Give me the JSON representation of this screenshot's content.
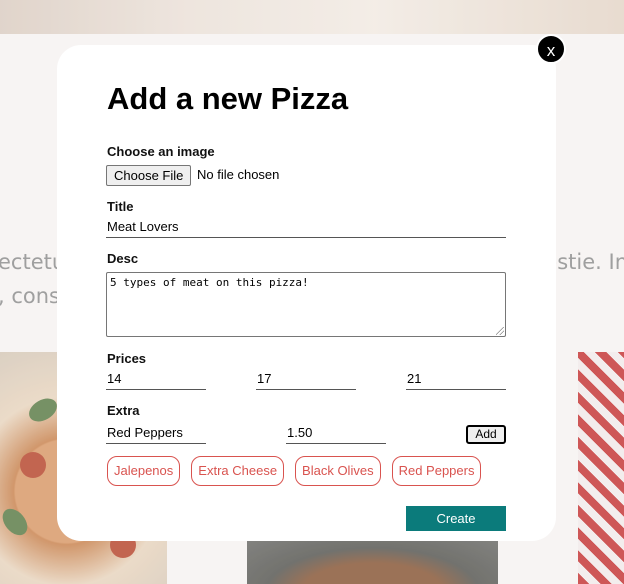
{
  "background": {
    "text_line1_left": "ectetu",
    "text_line2_left": ", cons",
    "text_line1_right": "estie. In"
  },
  "modal": {
    "close_label": "x",
    "title": "Add a new Pizza",
    "image": {
      "label": "Choose an image",
      "button_label": "Choose File",
      "status": "No file chosen"
    },
    "title_field": {
      "label": "Title",
      "value": "Meat Lovers"
    },
    "desc_field": {
      "label": "Desc",
      "value": "5 types of meat on this pizza!"
    },
    "prices": {
      "label": "Prices",
      "values": [
        "14",
        "17",
        "21"
      ]
    },
    "extra": {
      "label": "Extra",
      "name_value": "Red Peppers",
      "price_value": "1.50",
      "add_label": "Add",
      "chips": [
        "Jalepenos",
        "Extra Cheese",
        "Black Olives",
        "Red Peppers"
      ]
    },
    "create_label": "Create"
  },
  "colors": {
    "accent": "#0b7b7b",
    "chip": "#d9534f"
  }
}
